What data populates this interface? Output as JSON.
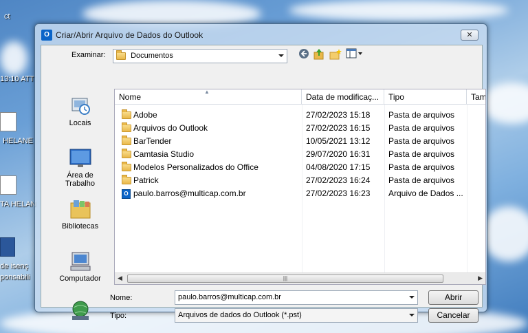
{
  "desktop": {
    "labels": [
      "ct",
      "13:10 ATT",
      "HELANE",
      "TA HELAN",
      "de isenç",
      "ponsabili"
    ]
  },
  "dialog": {
    "title": "Criar/Abrir Arquivo de Dados do Outlook",
    "close_glyph": "✕",
    "look_in_label": "Examinar:",
    "look_in_value": "Documentos",
    "places": [
      "Locais",
      "Área de Trabalho",
      "Bibliotecas",
      "Computador"
    ],
    "columns": [
      "Nome",
      "Data de modificaç...",
      "Tipo",
      "Tam"
    ],
    "files": [
      {
        "name": "Adobe",
        "date": "27/02/2023 15:18",
        "type": "Pasta de arquivos",
        "icon": "folder-icon"
      },
      {
        "name": "Arquivos do Outlook",
        "date": "27/02/2023 16:15",
        "type": "Pasta de arquivos",
        "icon": "folder-icon"
      },
      {
        "name": "BarTender",
        "date": "10/05/2021 13:12",
        "type": "Pasta de arquivos",
        "icon": "folder-icon"
      },
      {
        "name": "Camtasia Studio",
        "date": "29/07/2020 16:31",
        "type": "Pasta de arquivos",
        "icon": "folder-icon"
      },
      {
        "name": "Modelos Personalizados do Office",
        "date": "04/08/2020 17:15",
        "type": "Pasta de arquivos",
        "icon": "folder-icon"
      },
      {
        "name": "Patrick",
        "date": "27/02/2023 16:24",
        "type": "Pasta de arquivos",
        "icon": "folder-icon"
      },
      {
        "name": "paulo.barros@multicap.com.br",
        "date": "27/02/2023 16:23",
        "type": "Arquivo de Dados ...",
        "icon": "pst-file-icon"
      }
    ],
    "filename_label": "Nome:",
    "filename_value": "paulo.barros@multicap.com.br",
    "filetype_label": "Tipo:",
    "filetype_value": "Arquivos de dados do Outlook (*.pst)",
    "open_label": "Abrir",
    "cancel_label": "Cancelar"
  }
}
